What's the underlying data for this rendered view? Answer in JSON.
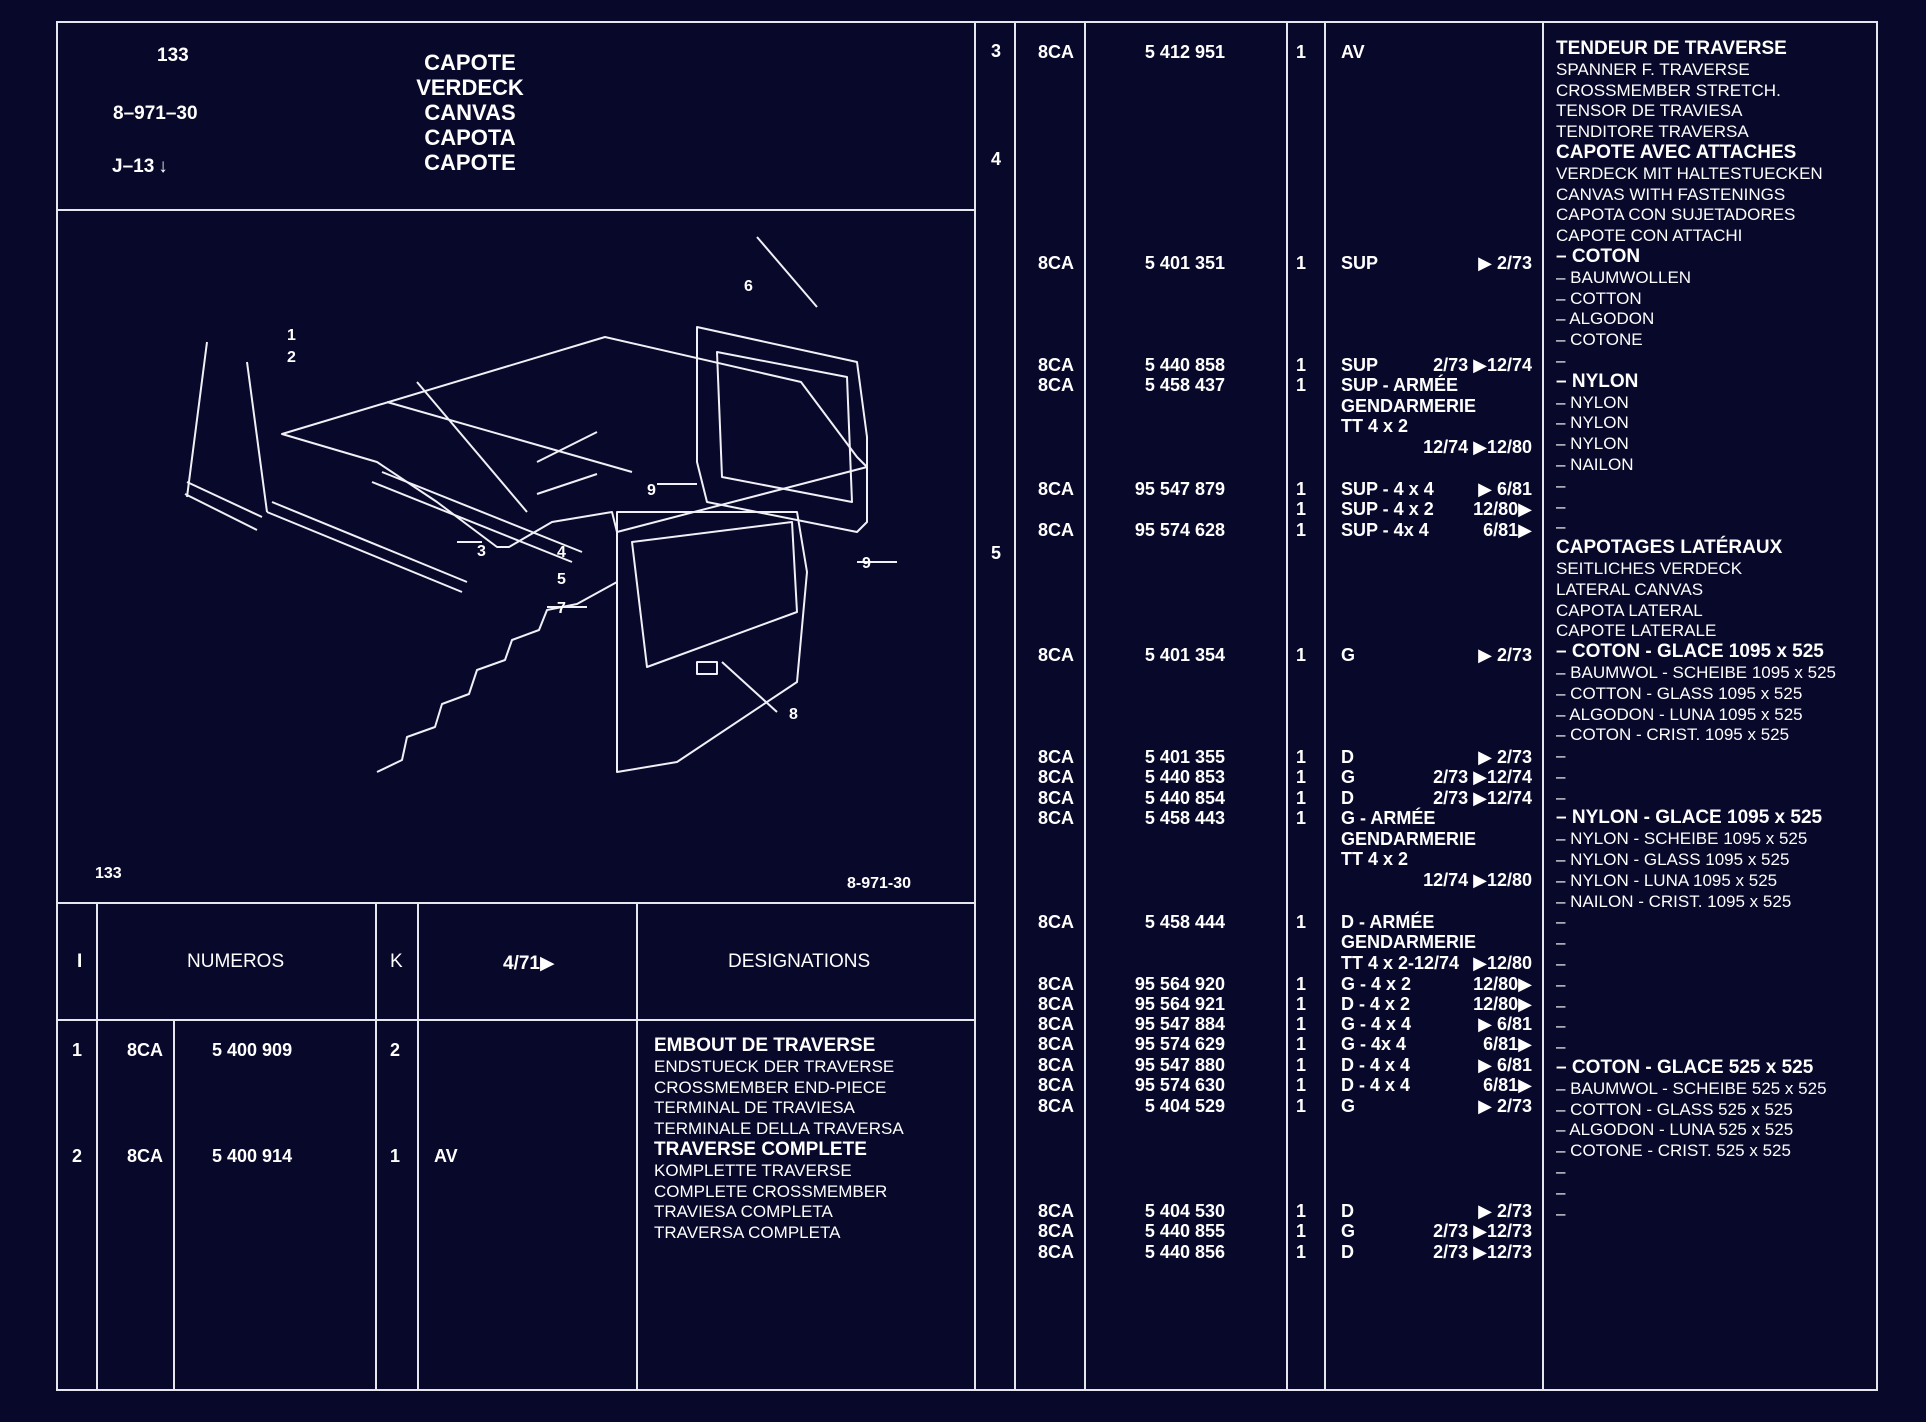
{
  "header": {
    "number": "133",
    "ref": "8–971–30",
    "sub": "J–13",
    "titles": [
      "CAPOTE",
      "VERDECK",
      "CANVAS",
      "CAPOTA",
      "CAPOTE"
    ]
  },
  "figure": {
    "corner_left": "133",
    "corner_right": "8-971-30",
    "callouts": [
      "1",
      "2",
      "3",
      "4",
      "5",
      "6",
      "7",
      "8",
      "9",
      "9"
    ]
  },
  "table_head": {
    "col_i": "I",
    "col_numeros": "NUMEROS",
    "col_k": "K",
    "col_date": "4/71▶",
    "col_designations": "DESIGNATIONS"
  },
  "left_rows": [
    {
      "i": "1",
      "code": "8CA",
      "num": "5 400 909",
      "k": "2",
      "pos": "",
      "desc": [
        "EMBOUT DE TRAVERSE",
        "ENDSTUECK DER TRAVERSE",
        "CROSSMEMBER END-PIECE",
        "TERMINAL DE TRAVIESA",
        "TERMINALE DELLA TRAVERSA"
      ]
    },
    {
      "i": "2",
      "code": "8CA",
      "num": "5 400 914",
      "k": "1",
      "pos": "AV",
      "desc": [
        "TRAVERSE COMPLETE",
        "KOMPLETTE TRAVERSE",
        "COMPLETE CROSSMEMBER",
        "TRAVIESA COMPLETA",
        "TRAVERSA COMPLETA"
      ]
    }
  ],
  "right_items": [
    "3",
    "4",
    "5"
  ],
  "right_rows": [
    {
      "code": "8CA",
      "num": "5 412 951",
      "k": "1",
      "pos": "AV",
      "date": ""
    },
    {
      "code": "8CA",
      "num": "5 401 351",
      "k": "1",
      "pos": "SUP",
      "date": "▶ 2/73"
    },
    {
      "code": "8CA",
      "num": "5 440 858",
      "k": "1",
      "pos": "SUP",
      "date": "2/73 ▶12/74"
    },
    {
      "code": "8CA",
      "num": "5 458 437",
      "k": "1",
      "pos": "SUP - ARMÉE",
      "date": ""
    },
    {
      "code": "",
      "num": "",
      "k": "",
      "pos": "GENDARMERIE",
      "date": ""
    },
    {
      "code": "",
      "num": "",
      "k": "",
      "pos": "TT 4 x 2",
      "date": ""
    },
    {
      "code": "",
      "num": "",
      "k": "",
      "pos": "",
      "date": "12/74 ▶12/80"
    },
    {
      "code": "8CA",
      "num": "95 547 879",
      "k": "1",
      "pos": "SUP - 4 x 4",
      "date": "▶ 6/81"
    },
    {
      "code": "",
      "num": "",
      "k": "1",
      "pos": "SUP - 4 x 2",
      "date": "12/80▶"
    },
    {
      "code": "8CA",
      "num": "95 574 628",
      "k": "1",
      "pos": "SUP - 4x 4",
      "date": "6/81▶"
    },
    {
      "code": "8CA",
      "num": "5 401 354",
      "k": "1",
      "pos": "G",
      "date": "▶ 2/73"
    },
    {
      "code": "8CA",
      "num": "5 401 355",
      "k": "1",
      "pos": "D",
      "date": "▶ 2/73"
    },
    {
      "code": "8CA",
      "num": "5 440 853",
      "k": "1",
      "pos": "G",
      "date": "2/73 ▶12/74"
    },
    {
      "code": "8CA",
      "num": "5 440 854",
      "k": "1",
      "pos": "D",
      "date": "2/73 ▶12/74"
    },
    {
      "code": "8CA",
      "num": "5 458 443",
      "k": "1",
      "pos": "G - ARMÉE",
      "date": ""
    },
    {
      "code": "",
      "num": "",
      "k": "",
      "pos": "GENDARMERIE",
      "date": ""
    },
    {
      "code": "",
      "num": "",
      "k": "",
      "pos": "TT 4 x 2",
      "date": ""
    },
    {
      "code": "",
      "num": "",
      "k": "",
      "pos": "",
      "date": "12/74 ▶12/80"
    },
    {
      "code": "8CA",
      "num": "5 458 444",
      "k": "1",
      "pos": "D - ARMÉE",
      "date": ""
    },
    {
      "code": "",
      "num": "",
      "k": "",
      "pos": "GENDARMERIE",
      "date": ""
    },
    {
      "code": "",
      "num": "",
      "k": "",
      "pos": "TT 4 x 2-12/74",
      "date": "▶12/80"
    },
    {
      "code": "8CA",
      "num": "95 564 920",
      "k": "1",
      "pos": "G - 4 x 2",
      "date": "12/80▶"
    },
    {
      "code": "8CA",
      "num": "95 564 921",
      "k": "1",
      "pos": "D - 4 x 2",
      "date": "12/80▶"
    },
    {
      "code": "8CA",
      "num": "95 547 884",
      "k": "1",
      "pos": "G - 4 x 4",
      "date": "▶ 6/81"
    },
    {
      "code": "8CA",
      "num": "95 574 629",
      "k": "1",
      "pos": "G - 4x 4",
      "date": "6/81▶"
    },
    {
      "code": "8CA",
      "num": "95 547 880",
      "k": "1",
      "pos": "D - 4 x 4",
      "date": "▶ 6/81"
    },
    {
      "code": "8CA",
      "num": "95 574 630",
      "k": "1",
      "pos": "D - 4 x 4",
      "date": "6/81▶"
    },
    {
      "code": "8CA",
      "num": "5 404 529",
      "k": "1",
      "pos": "G",
      "date": "▶ 2/73"
    },
    {
      "code": "8CA",
      "num": "5 404 530",
      "k": "1",
      "pos": "D",
      "date": "▶ 2/73"
    },
    {
      "code": "8CA",
      "num": "5 440 855",
      "k": "1",
      "pos": "G",
      "date": "2/73 ▶12/73"
    },
    {
      "code": "8CA",
      "num": "5 440 856",
      "k": "1",
      "pos": "D",
      "date": "2/73 ▶12/73"
    }
  ],
  "right_desc": [
    "TENDEUR DE TRAVERSE",
    "SPANNER F. TRAVERSE",
    "CROSSMEMBER STRETCH.",
    "TENSOR DE TRAVIESA",
    "TENDITORE TRAVERSA",
    "CAPOTE AVEC ATTACHES",
    "VERDECK MIT HALTESTUECKEN",
    "CANVAS WITH FASTENINGS",
    "CAPOTA CON SUJETADORES",
    "CAPOTE CON ATTACHI",
    "– COTON",
    "– BAUMWOLLEN",
    "– COTTON",
    "– ALGODON",
    "– COTONE",
    "–",
    "– NYLON",
    "– NYLON",
    "– NYLON",
    "– NYLON",
    "– NAILON",
    "–",
    "–",
    "–",
    "CAPOTAGES LATÉRAUX",
    "SEITLICHES VERDECK",
    "LATERAL CANVAS",
    "CAPOTA LATERAL",
    "CAPOTE LATERALE",
    "– COTON   - GLACE 1095 x 525",
    "– BAUMWOL - SCHEIBE 1095 x 525",
    "– COTTON - GLASS 1095 x 525",
    "– ALGODON - LUNA 1095 x 525",
    "– COTON - CRIST. 1095 x 525",
    "–",
    "–",
    "–",
    "– NYLON - GLACE 1095 x 525",
    "– NYLON - SCHEIBE 1095 x 525",
    "– NYLON - GLASS 1095 x 525",
    "– NYLON - LUNA 1095 x 525",
    "– NAILON - CRIST. 1095 x 525",
    "–",
    "–",
    "–",
    "–",
    "–",
    "–",
    "–",
    "– COTON - GLACE 525 x 525",
    "– BAUMWOL - SCHEIBE 525 x 525",
    "– COTTON - GLASS 525 x 525",
    "– ALGODON - LUNA 525 x 525",
    "– COTONE - CRIST. 525 x 525",
    "–",
    "–",
    "–"
  ],
  "colors": {
    "background": "#08082a",
    "line": "#e8e8f0",
    "text": "#ffffff"
  }
}
